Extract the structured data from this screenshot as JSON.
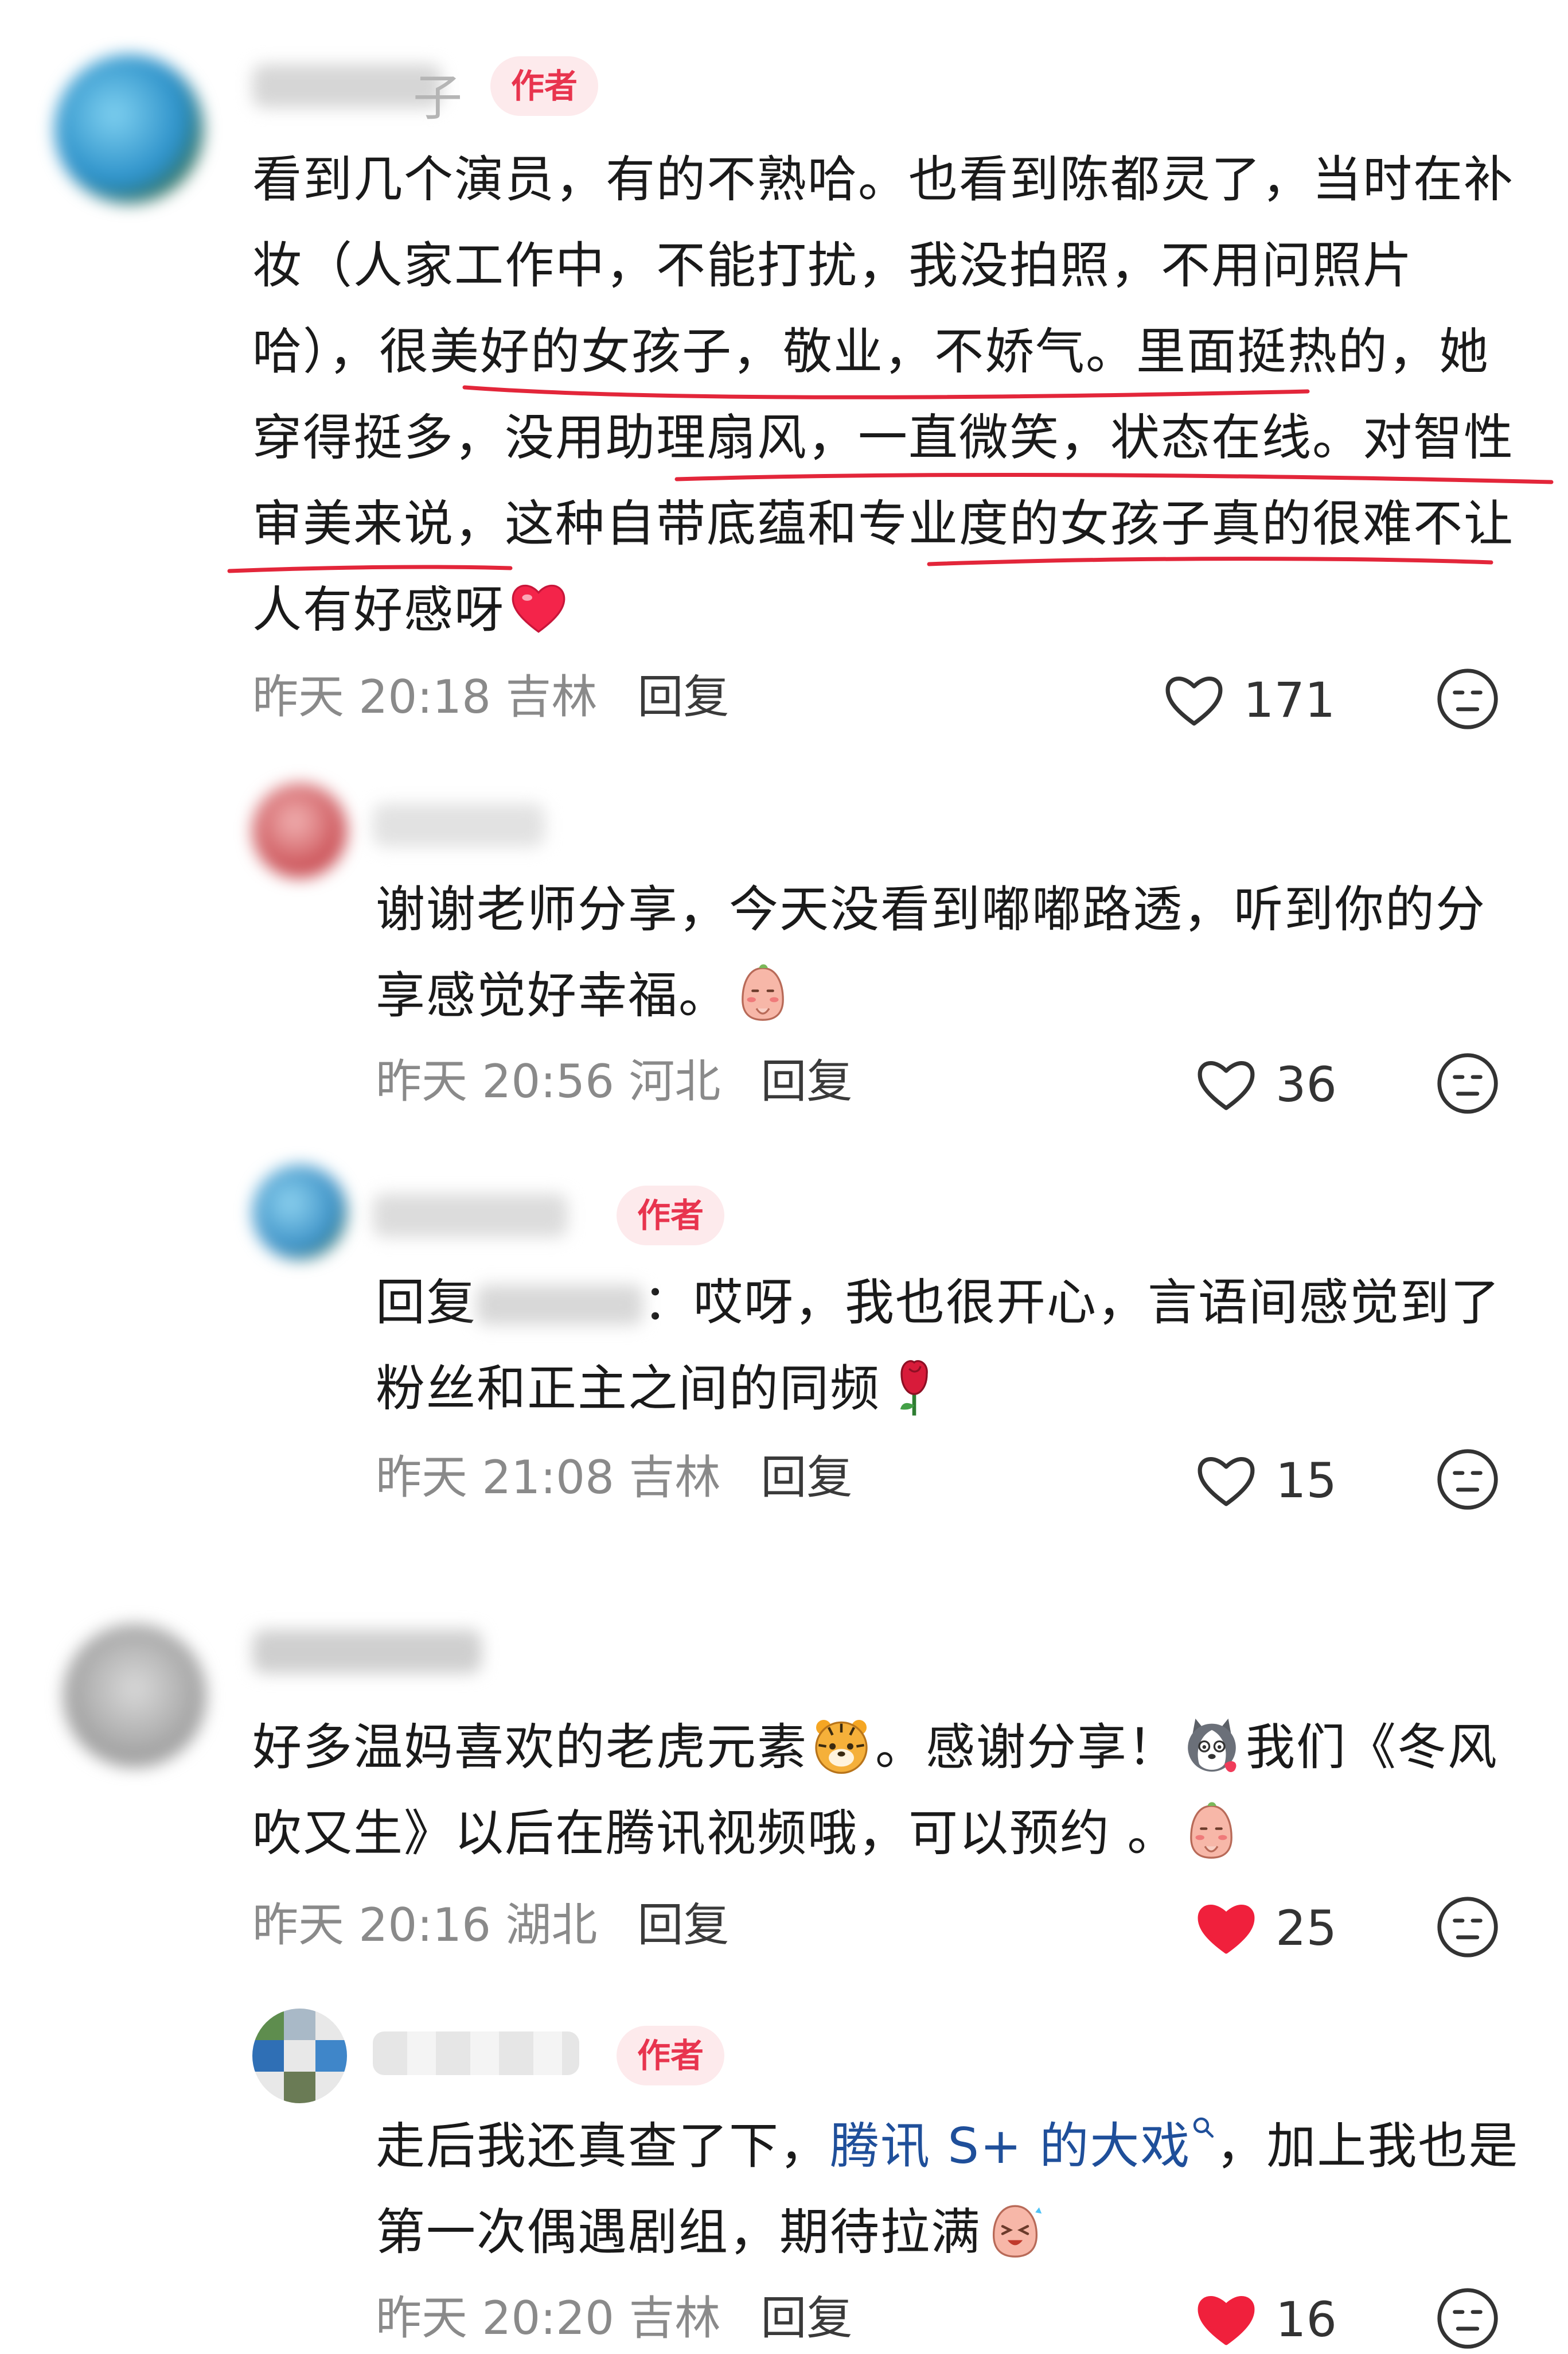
{
  "badge_label": "作者",
  "comments": [
    {
      "name_hint": "子",
      "text_parts": [
        "看到几个演员，有的不熟哈。也看到陈都灵了，当时在补妆（人家工作中，不能打扰，我没拍照，不用问照片哈），很美好的女孩子，敬业，不娇气。里面挺热的，她穿得挺多，没用助理扇风，一直微笑，状态在线。对智性审美来说，这种自带底蕴和专业度的女孩子真的很难不让人有好感呀"
      ],
      "time": "昨天 20:18",
      "location": "吉林",
      "reply": "回复",
      "likes": "171"
    },
    {
      "text_parts": [
        "谢谢老师分享，今天没看到嘟嘟路透，听到你的分享感觉好幸福。"
      ],
      "time": "昨天 20:56",
      "location": "河北",
      "reply": "回复",
      "likes": "36"
    },
    {
      "reply_prefix": "回复",
      "text_parts": [
        "：哎呀，我也很开心，言语间感觉到了粉丝和正主之间的同频"
      ],
      "time": "昨天 21:08",
      "location": "吉林",
      "reply": "回复",
      "likes": "15"
    },
    {
      "text_parts": [
        "好多温妈喜欢的老虎元素",
        "。感谢分享！",
        "我们《冬风吹又生》以后在腾讯视频哦，可以预约 。"
      ],
      "time": "昨天 20:16",
      "location": "湖北",
      "reply": "回复",
      "likes": "25"
    },
    {
      "text_parts": [
        "走后我还真查了下，",
        "腾讯 S+ 的大戏",
        "，加上我也是第一次偶遇剧组，期待拉满"
      ],
      "time": "昨天 20:20",
      "location": "吉林",
      "reply": "回复",
      "likes": "16"
    }
  ],
  "colors": {
    "badge_bg": "#fdeaec",
    "badge_text": "#e8344e",
    "liked": "#f0203c",
    "link": "#1f4f9a",
    "underline": "#e3263a"
  }
}
